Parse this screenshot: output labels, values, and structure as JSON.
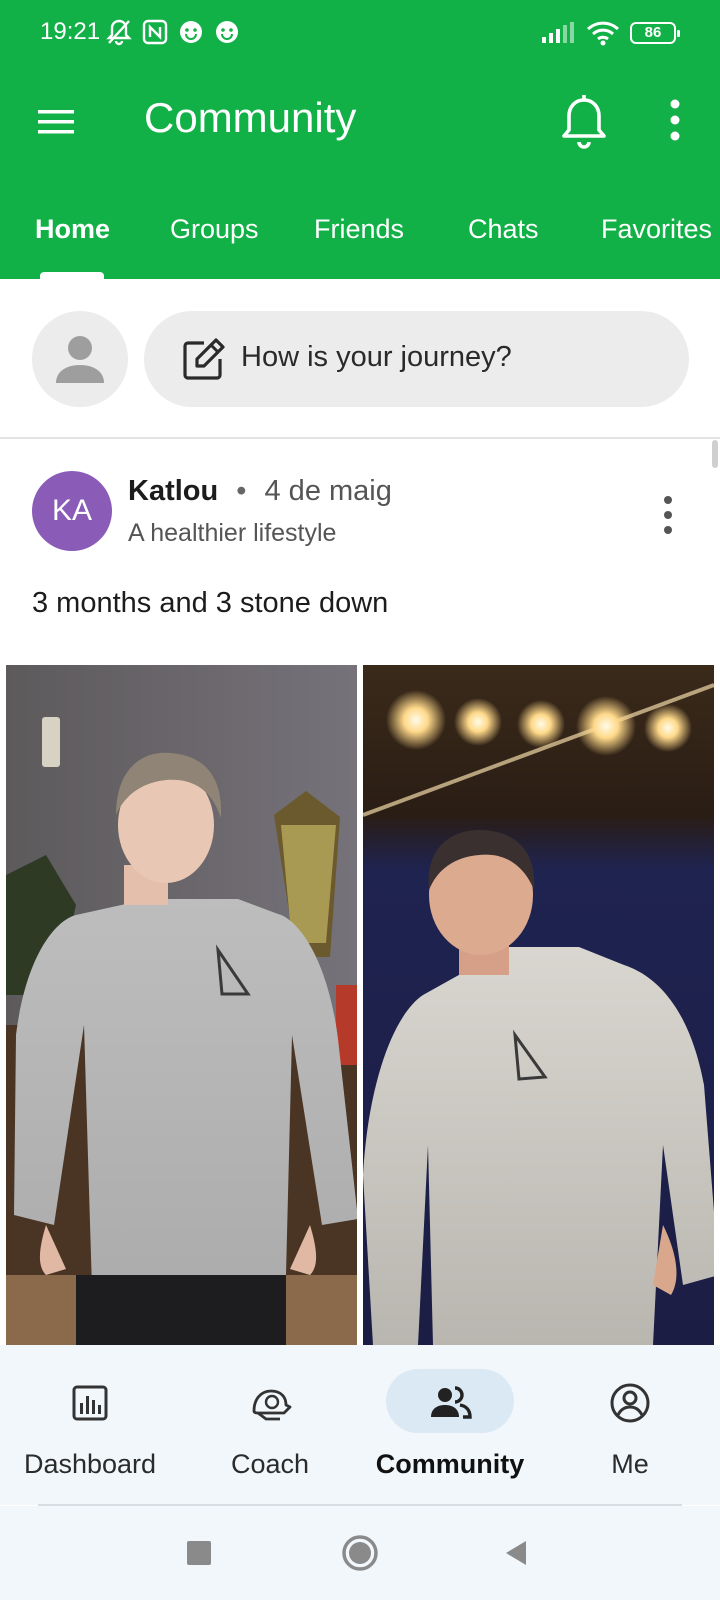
{
  "status_bar": {
    "time": "19:21",
    "battery": "86",
    "left_icons": [
      "mute-notifications-icon",
      "nfc-icon",
      "smiley-icon",
      "smiley-icon"
    ],
    "right_icons": [
      "signal-icon",
      "wifi-icon",
      "battery-icon"
    ]
  },
  "toolbar": {
    "title": "Community",
    "icons": [
      "menu-icon",
      "bell-icon",
      "more-vert-icon"
    ],
    "color": "#12b147"
  },
  "tabs": [
    {
      "label": "Home",
      "active": true
    },
    {
      "label": "Groups",
      "active": false
    },
    {
      "label": "Friends",
      "active": false
    },
    {
      "label": "Chats",
      "active": false
    },
    {
      "label": "Favorites",
      "active": false
    }
  ],
  "composer": {
    "placeholder": "How is your journey?",
    "icon": "edit-icon"
  },
  "post": {
    "avatar_initials": "KA",
    "avatar_color": "#8a5cb8",
    "author": "Katlou",
    "separator": "•",
    "date": "4 de maig",
    "group": "A healthier lifestyle",
    "text": "3 months and 3 stone down",
    "photos": [
      "before-photo",
      "after-photo"
    ]
  },
  "bottom_nav": [
    {
      "label": "Dashboard",
      "icon": "dashboard-icon",
      "active": false
    },
    {
      "label": "Coach",
      "icon": "coach-icon",
      "active": false
    },
    {
      "label": "Community",
      "icon": "community-icon",
      "active": true
    },
    {
      "label": "Me",
      "icon": "profile-icon",
      "active": false
    }
  ],
  "system_nav": [
    "recents-button",
    "home-button",
    "back-button"
  ]
}
